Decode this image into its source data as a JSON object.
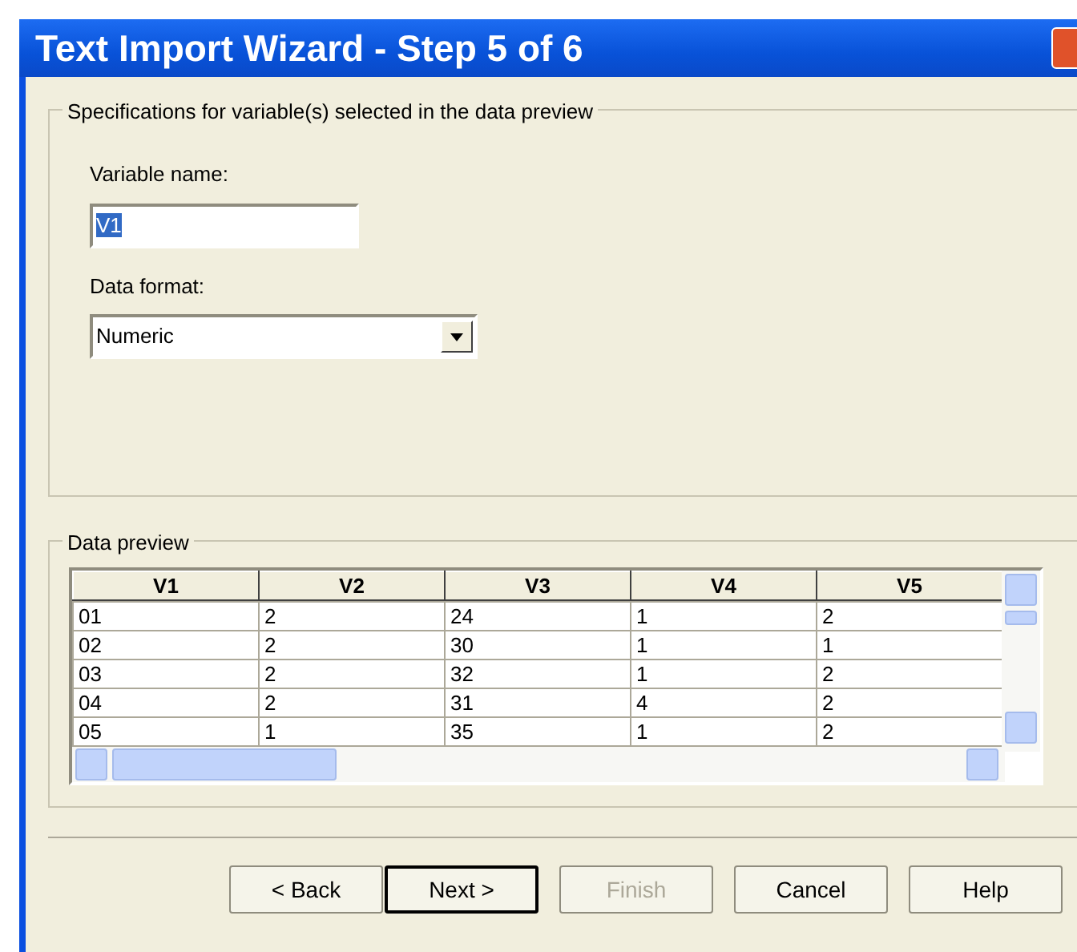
{
  "window": {
    "title": "Text Import Wizard - Step 5 of 6"
  },
  "specifications": {
    "legend": "Specifications for variable(s) selected in the data preview",
    "variable_name": {
      "label": "Variable name:",
      "value": "V1",
      "selected": true
    },
    "data_format": {
      "label": "Data format:",
      "value": "Numeric"
    }
  },
  "data_preview": {
    "legend": "Data preview",
    "columns": [
      "V1",
      "V2",
      "V3",
      "V4",
      "V5"
    ],
    "rows": [
      [
        "01",
        "2",
        "24",
        "1",
        "2"
      ],
      [
        "02",
        "2",
        "30",
        "1",
        "1"
      ],
      [
        "03",
        "2",
        "32",
        "1",
        "2"
      ],
      [
        "04",
        "2",
        "31",
        "4",
        "2"
      ],
      [
        "05",
        "1",
        "35",
        "1",
        "2"
      ]
    ]
  },
  "buttons": [
    {
      "label": "< Back",
      "disabled": false,
      "default": false
    },
    {
      "label": "Next >",
      "disabled": false,
      "default": true
    },
    {
      "label": "Finish",
      "disabled": true,
      "default": false
    },
    {
      "label": "Cancel",
      "disabled": false,
      "default": false
    },
    {
      "label": "Help",
      "disabled": false,
      "default": false
    }
  ]
}
